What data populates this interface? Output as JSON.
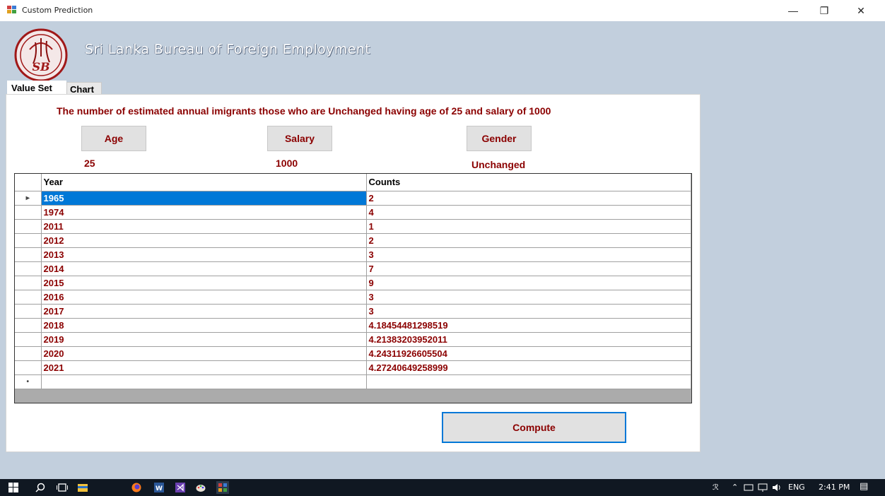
{
  "window": {
    "title": "Custom Prediction",
    "minimize_glyph": "—",
    "restore_glyph": "❐",
    "close_glyph": "✕"
  },
  "header": {
    "org_name": "Sri Lanka Bureau of Foreign Employment",
    "logo_text": "SB"
  },
  "tabs": [
    {
      "label": "Value Set",
      "active": true
    },
    {
      "label": "Chart",
      "active": false
    }
  ],
  "main": {
    "description": "The number of estimated annual imigrants those who are Unchanged having age of 25 and salary of 1000",
    "age_button": "Age",
    "salary_button": "Salary",
    "gender_button": "Gender",
    "age_value": "25",
    "salary_value": "1000",
    "gender_value": "Unchanged",
    "compute_button": "Compute"
  },
  "grid": {
    "columns": [
      "Year",
      "Counts"
    ],
    "current_row_glyph": "▸",
    "new_row_glyph": "•",
    "rows": [
      {
        "year": "1965",
        "count": "2"
      },
      {
        "year": "1974",
        "count": "4"
      },
      {
        "year": "2011",
        "count": "1"
      },
      {
        "year": "2012",
        "count": "2"
      },
      {
        "year": "2013",
        "count": "3"
      },
      {
        "year": "2014",
        "count": "7"
      },
      {
        "year": "2015",
        "count": "9"
      },
      {
        "year": "2016",
        "count": "3"
      },
      {
        "year": "2017",
        "count": "3"
      },
      {
        "year": "2018",
        "count": "4.18454481298519"
      },
      {
        "year": "2019",
        "count": "4.21383203952011"
      },
      {
        "year": "2020",
        "count": "4.24311926605504"
      },
      {
        "year": "2021",
        "count": "4.27240649258999"
      }
    ]
  },
  "taskbar": {
    "people_glyph": "ℛ",
    "chevron_glyph": "⌃",
    "language": "ENG",
    "time": "2:41 PM",
    "notification_glyph": "▤"
  },
  "colors": {
    "text_accent": "#8b0000",
    "selection": "#0078d7",
    "background": "#c2cfdd"
  }
}
